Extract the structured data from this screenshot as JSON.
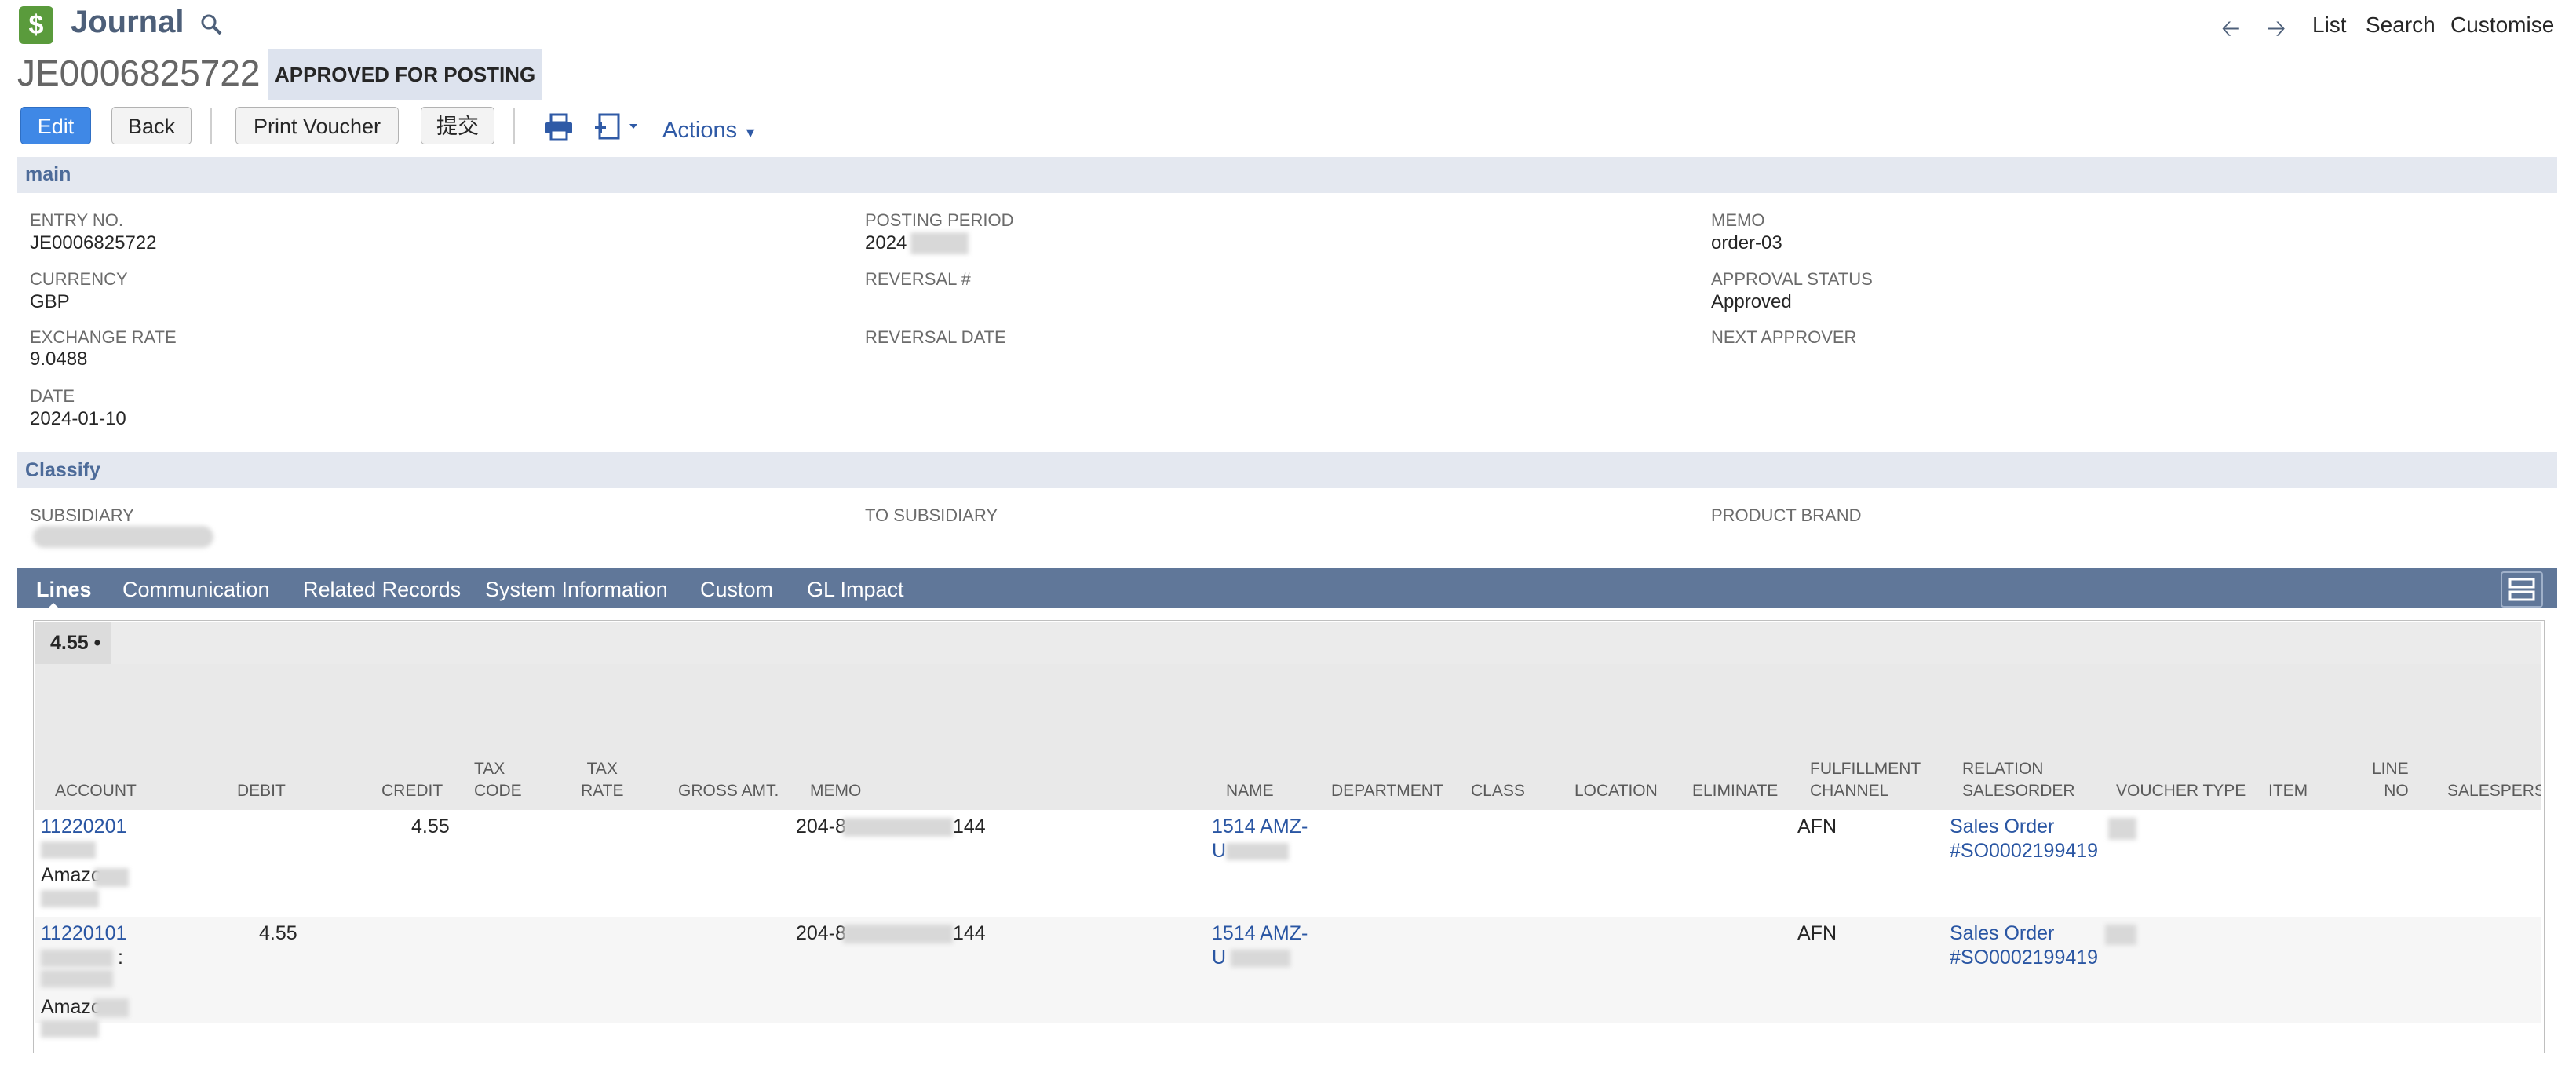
{
  "app": {
    "title": "Journal",
    "icon": "dollar-journal-icon"
  },
  "top_nav": {
    "back_icon": "arrow-left-icon",
    "forward_icon": "arrow-right-icon",
    "list": "List",
    "search": "Search",
    "customise": "Customise"
  },
  "record": {
    "id": "JE0006825722",
    "status": "APPROVED FOR POSTING"
  },
  "buttons": {
    "edit": "Edit",
    "back": "Back",
    "print_voucher": "Print Voucher",
    "submit": "提交",
    "actions": "Actions"
  },
  "sections": {
    "main": {
      "title": "main",
      "fields": {
        "entry_no": {
          "label": "ENTRY NO.",
          "value": "JE0006825722"
        },
        "currency": {
          "label": "CURRENCY",
          "value": "GBP"
        },
        "exchange_rate": {
          "label": "EXCHANGE RATE",
          "value": "9.0488"
        },
        "date": {
          "label": "DATE",
          "value": "2024-01-10"
        },
        "posting_period": {
          "label": "POSTING PERIOD",
          "value": "2024"
        },
        "reversal_no": {
          "label": "REVERSAL #",
          "value": ""
        },
        "reversal_date": {
          "label": "REVERSAL DATE",
          "value": ""
        },
        "memo": {
          "label": "MEMO",
          "value": "order-03"
        },
        "approval_status": {
          "label": "APPROVAL STATUS",
          "value": "Approved"
        },
        "next_approver": {
          "label": "NEXT APPROVER",
          "value": ""
        }
      }
    },
    "classify": {
      "title": "Classify",
      "fields": {
        "subsidiary": {
          "label": "SUBSIDIARY"
        },
        "to_subsidiary": {
          "label": "TO SUBSIDIARY"
        },
        "product_brand": {
          "label": "PRODUCT BRAND"
        }
      }
    }
  },
  "tabs": [
    {
      "label": "Lines",
      "active": true
    },
    {
      "label": "Communication",
      "active": false
    },
    {
      "label": "Related Records",
      "active": false
    },
    {
      "label": "System Information",
      "active": false
    },
    {
      "label": "Custom",
      "active": false
    },
    {
      "label": "GL Impact",
      "active": false
    }
  ],
  "lines": {
    "total": "4.55 •",
    "columns": {
      "account": "ACCOUNT",
      "debit": "DEBIT",
      "credit": "CREDIT",
      "tax_code_1": "TAX",
      "tax_code_2": "CODE",
      "tax_rate_1": "TAX",
      "tax_rate_2": "RATE",
      "gross_amt": "GROSS AMT.",
      "memo": "MEMO",
      "name": "NAME",
      "department": "DEPARTMENT",
      "class": "CLASS",
      "location": "LOCATION",
      "eliminate": "ELIMINATE",
      "fulfillment_1": "FULFILLMENT",
      "fulfillment_2": "CHANNEL",
      "relation_1": "RELATION",
      "relation_2": "SALESORDER",
      "voucher_type": "VOUCHER TYPE",
      "item": "ITEM",
      "line_no_1": "LINE",
      "line_no_2": "NO",
      "salesperson": "SALESPERSON"
    },
    "rows": [
      {
        "account": "11220201",
        "account_line3": "Amazo",
        "debit": "",
        "credit": "4.55",
        "memo_start": "204-8",
        "memo_end": "144",
        "name_1": "1514 AMZ-",
        "name_2": "U",
        "fulfillment": "AFN",
        "relation_1": "Sales Order",
        "relation_2": "#SO0002199419"
      },
      {
        "account": "11220101",
        "account_line2": ":",
        "account_line3": "Amazo",
        "debit": "4.55",
        "credit": "",
        "memo_start": "204-8",
        "memo_end": "144",
        "name_1": "1514 AMZ-",
        "name_2": "U",
        "fulfillment": "AFN",
        "relation_1": "Sales Order",
        "relation_2": "#SO0002199419"
      }
    ]
  },
  "colors": {
    "tab_bar": "#607799",
    "section_bar": "#e4e8f0",
    "link": "#2a56a3",
    "primary_button": "#3f88e6"
  }
}
